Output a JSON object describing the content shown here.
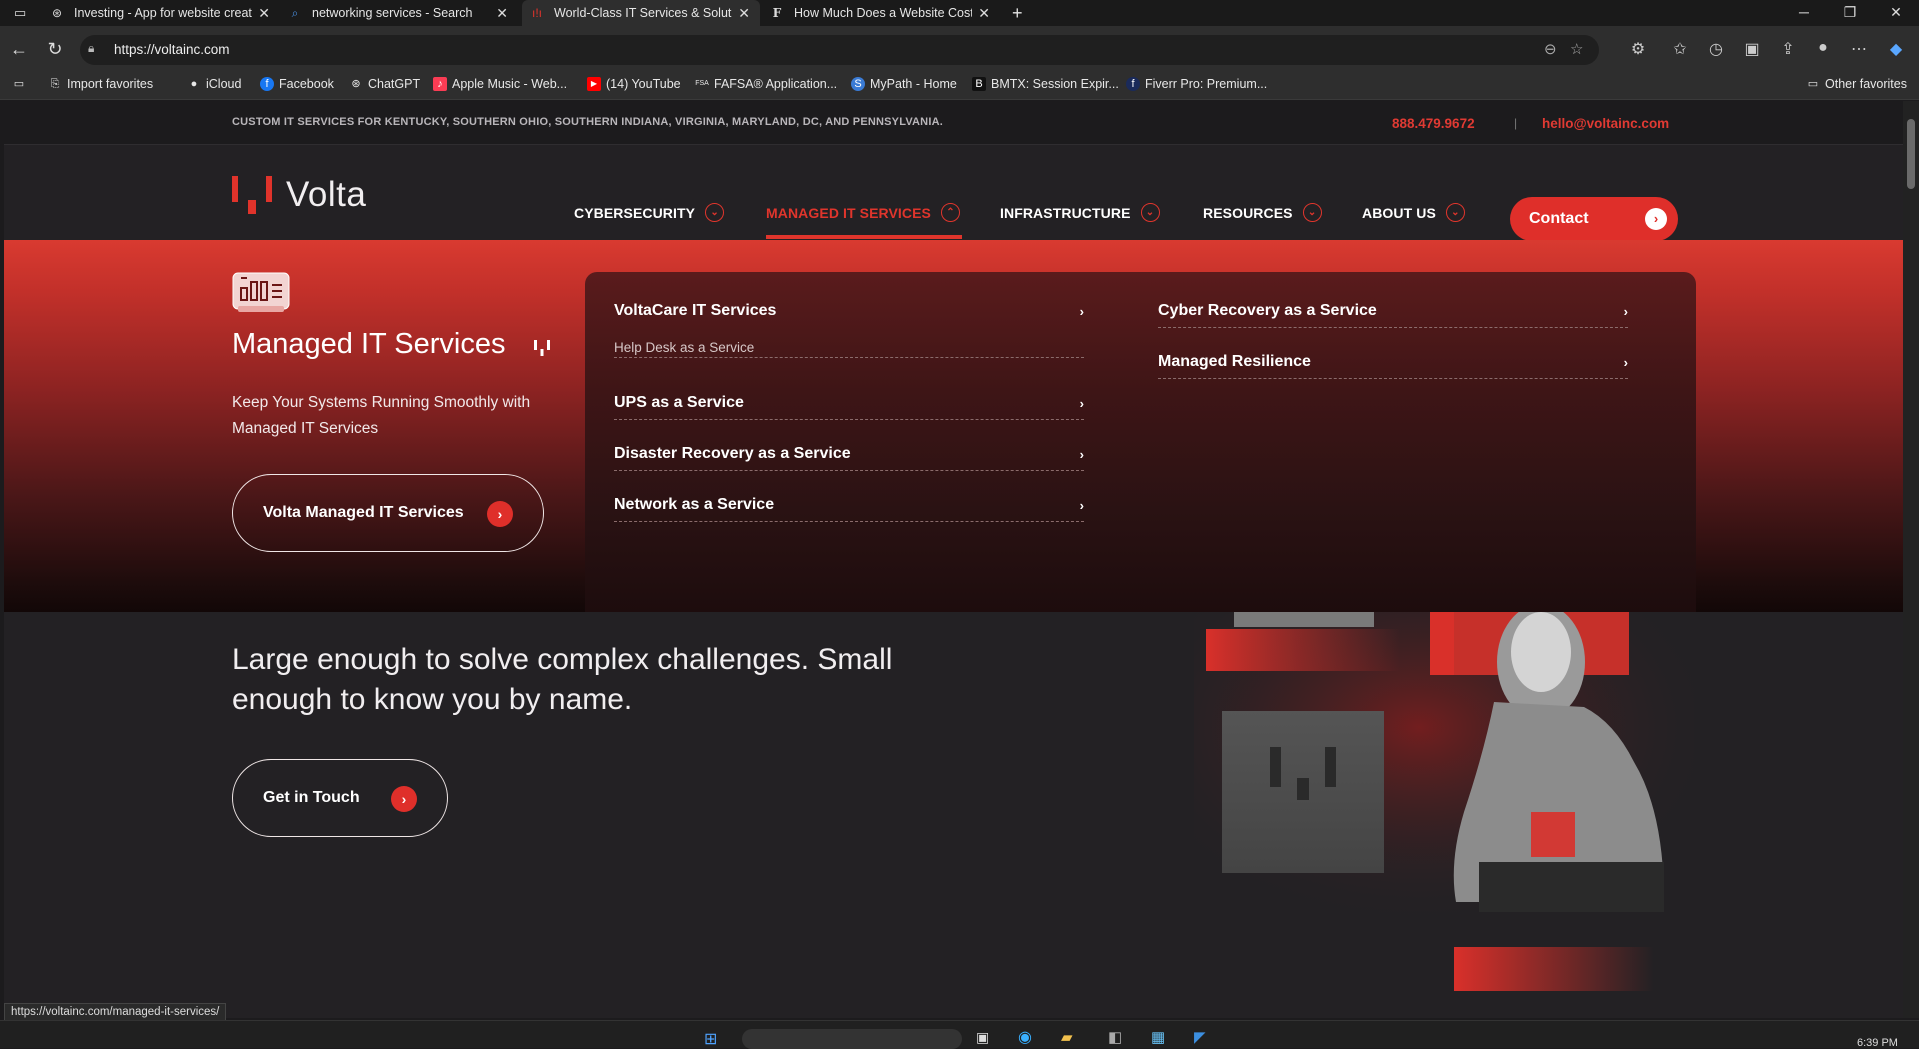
{
  "browser": {
    "tabs": [
      {
        "title": "Investing - App for website creati",
        "icon": "openai-icon"
      },
      {
        "title": "networking services - Search",
        "icon": "search-icon"
      },
      {
        "title": "World-Class IT Services & Solution",
        "icon": "volta-icon",
        "active": true
      },
      {
        "title": "How Much Does a Website Cost?",
        "icon": "f-icon"
      }
    ],
    "url": "https://voltainc.com",
    "favorites": [
      "Import favorites",
      "iCloud",
      "Facebook",
      "ChatGPT",
      "Apple Music - Web...",
      "(14) YouTube",
      "FAFSA® Application...",
      "MyPath - Home",
      "BMTX: Session Expir...",
      "Fiverr Pro: Premium..."
    ],
    "other_favorites": "Other favorites",
    "status_url": "https://voltainc.com/managed-it-services/",
    "clock": "6:39 PM"
  },
  "site": {
    "served_areas": "CUSTOM IT SERVICES FOR KENTUCKY, SOUTHERN OHIO, SOUTHERN INDIANA, VIRGINIA, MARYLAND, DC, AND PENNSYLVANIA.",
    "phone": "888.479.9672",
    "separator": "|",
    "email": "hello@voltainc.com",
    "logo_text": "Volta",
    "nav": [
      {
        "label": "CYBERSECURITY"
      },
      {
        "label": "MANAGED IT SERVICES",
        "active": true
      },
      {
        "label": "INFRASTRUCTURE"
      },
      {
        "label": "RESOURCES"
      },
      {
        "label": "ABOUT US"
      }
    ],
    "contact_label": "Contact",
    "accent_color": "#df2f2a",
    "mega_menu": {
      "title": "Managed IT Services",
      "description": "Keep Your Systems Running Smoothly with Managed IT Services",
      "button_label": "Volta Managed IT Services",
      "links_left": [
        {
          "label": "VoltaCare IT Services",
          "sub": "Help Desk as a Service"
        },
        {
          "label": "UPS as a Service"
        },
        {
          "label": "Disaster Recovery as a Service"
        },
        {
          "label": "Network as a Service"
        }
      ],
      "links_right": [
        {
          "label": "Cyber Recovery as a Service"
        },
        {
          "label": "Managed Resilience"
        }
      ]
    },
    "hero": {
      "headline": "Large enough to solve complex challenges. Small enough to know you by name.",
      "cta_label": "Get in Touch"
    }
  }
}
